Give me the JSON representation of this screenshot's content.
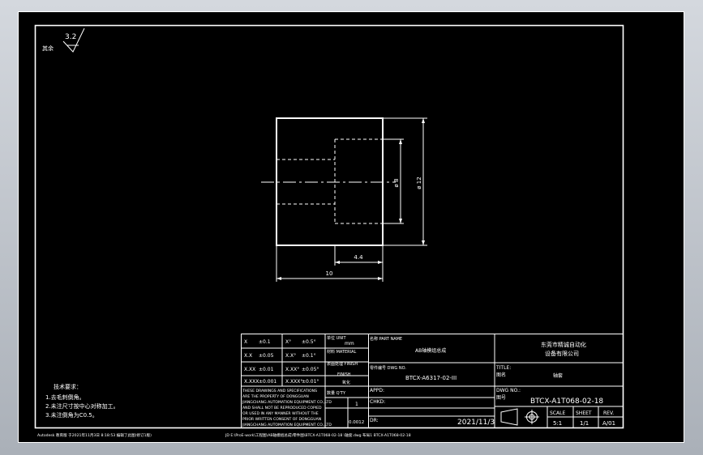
{
  "roughness": {
    "value": "3.2",
    "prefix_label": "其余"
  },
  "dimensions": {
    "inner_dia": "ø 8",
    "outer_dia": "ø 12",
    "bore_depth": "4.4",
    "length": "10"
  },
  "tolerance_table": {
    "rows": [
      [
        "X",
        "±0.1",
        "X°",
        "±0.5°"
      ],
      [
        "X.X",
        "±0.05",
        "X.X°",
        "±0.1°"
      ],
      [
        "X.XX",
        "±0.01",
        "X.XX°",
        "±0.05°"
      ],
      [
        "X.XXX",
        "±0.001",
        "X.XXX°",
        "±0.01°"
      ]
    ],
    "unit_label": "单位 UNIT",
    "unit_value": "mm",
    "material_label": "材料 MATERIAL",
    "finish_label": "表面处理 FINISH",
    "finish_value": "FINISH",
    "finish_value2": "氧化",
    "qty_label": "数量 Q'TY",
    "qty_value": "1",
    "weight_value": "0.0012",
    "notice": [
      "THESE DRAWINGS AND SPECIFICATIONS",
      "ARE THE PROPERTY OF DONGGUAN",
      "JIANGCHANG AUTOMATION EQUIPMENT CO.,LTD",
      "AND SHALL NOT BE REPRODUCED COPIED",
      "OR USED IN ANY MANNER WITHOUT THE",
      "PRIOR WRITTEN CONSENT OF DONGGUAN",
      "JIANGCHANG AUTOMATION EQUIPMENT CO.,LTD"
    ]
  },
  "title_block": {
    "name_label": "名称 PART NAME",
    "name_value": "AB轴模组总成",
    "part_no_label": "零件编号 DWG NO.",
    "part_no_value": "BTCX-A6317-02-III",
    "appd_label": "APPD:",
    "chkd_label": "CHKD:",
    "dr_label": "DR:",
    "date": "2021/11/3",
    "company": [
      "东莞市精诚自动化",
      "设备有限公司"
    ],
    "title_label": "TITLE:",
    "title_cn": "图名",
    "title_value": "轴套",
    "dwg_label": "DWG NO.:",
    "dwg_cn": "图号",
    "dwg_value": "BTCX-A1T068-02-18",
    "scale_label": "SCALE",
    "scale_value": "5:1",
    "sheet_label": "SHEET",
    "sheet_value": "1/1",
    "rev_label": "REV.",
    "rev_value": "A/01"
  },
  "notes": {
    "title": "技术要求：",
    "items": [
      "1.去毛刺倒角。",
      "2.未注尺寸按中心对称加工。",
      "3.未注倒角为C0.5。"
    ]
  },
  "footer": {
    "left": "Autodesk 教育版  于2021年11月3日 8:18:53 编辑了此图(修订1版)",
    "right": "JD E:\\ProE-work\\工程图\\AB轴模组总成\\零件图\\BTCX-A1T068-02-18 \\轴套.dwg  布局1  BTCX-A1T068-02-18"
  }
}
